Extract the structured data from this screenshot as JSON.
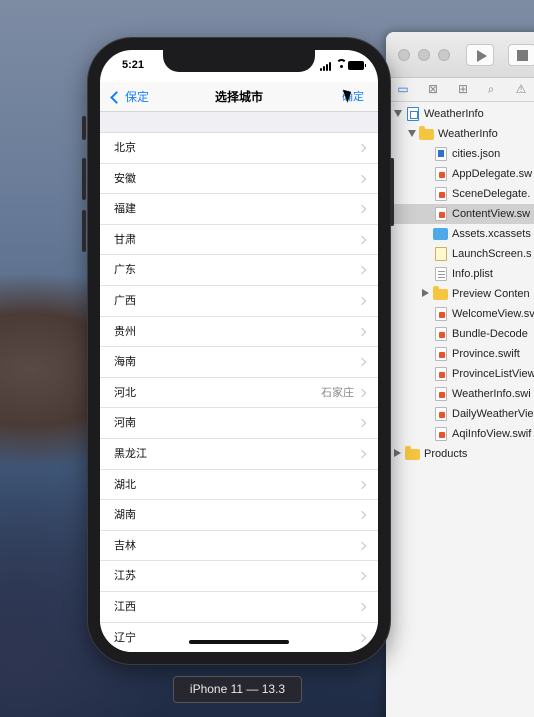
{
  "simulator": {
    "status_time": "5:21",
    "device_label": "iPhone 11 — 13.3"
  },
  "navbar": {
    "back_label": "保定",
    "title": "选择城市",
    "right_label": "确定",
    "accent_color": "#147efb"
  },
  "provinces": [
    {
      "name": "北京",
      "detail": ""
    },
    {
      "name": "安徽",
      "detail": ""
    },
    {
      "name": "福建",
      "detail": ""
    },
    {
      "name": "甘肃",
      "detail": ""
    },
    {
      "name": "广东",
      "detail": ""
    },
    {
      "name": "广西",
      "detail": ""
    },
    {
      "name": "贵州",
      "detail": ""
    },
    {
      "name": "海南",
      "detail": ""
    },
    {
      "name": "河北",
      "detail": "石家庄"
    },
    {
      "name": "河南",
      "detail": ""
    },
    {
      "name": "黑龙江",
      "detail": ""
    },
    {
      "name": "湖北",
      "detail": ""
    },
    {
      "name": "湖南",
      "detail": ""
    },
    {
      "name": "吉林",
      "detail": ""
    },
    {
      "name": "江苏",
      "detail": ""
    },
    {
      "name": "江西",
      "detail": ""
    },
    {
      "name": "辽宁",
      "detail": ""
    }
  ],
  "project_navigator": {
    "items": [
      {
        "label": "WeatherInfo",
        "icon": "project-icon"
      },
      {
        "label": "WeatherInfo",
        "icon": "folder-icon"
      },
      {
        "label": "cities.json",
        "icon": "json-file-icon"
      },
      {
        "label": "AppDelegate.sw",
        "icon": "swift-file-icon"
      },
      {
        "label": "SceneDelegate.",
        "icon": "swift-file-icon"
      },
      {
        "label": "ContentView.sw",
        "icon": "swift-file-icon"
      },
      {
        "label": "Assets.xcassets",
        "icon": "assets-icon"
      },
      {
        "label": "LaunchScreen.s",
        "icon": "storyboard-icon"
      },
      {
        "label": "Info.plist",
        "icon": "plist-icon"
      },
      {
        "label": "Preview Conten",
        "icon": "folder-icon"
      },
      {
        "label": "WelcomeView.sv",
        "icon": "swift-file-icon"
      },
      {
        "label": "Bundle-Decode",
        "icon": "swift-file-icon"
      },
      {
        "label": "Province.swift",
        "icon": "swift-file-icon"
      },
      {
        "label": "ProvinceListView",
        "icon": "swift-file-icon"
      },
      {
        "label": "WeatherInfo.swi",
        "icon": "swift-file-icon"
      },
      {
        "label": "DailyWeatherVie",
        "icon": "swift-file-icon"
      },
      {
        "label": "AqiInfoView.swif",
        "icon": "swift-file-icon"
      },
      {
        "label": "Products",
        "icon": "folder-icon"
      }
    ],
    "selected": "ContentView.sw"
  }
}
